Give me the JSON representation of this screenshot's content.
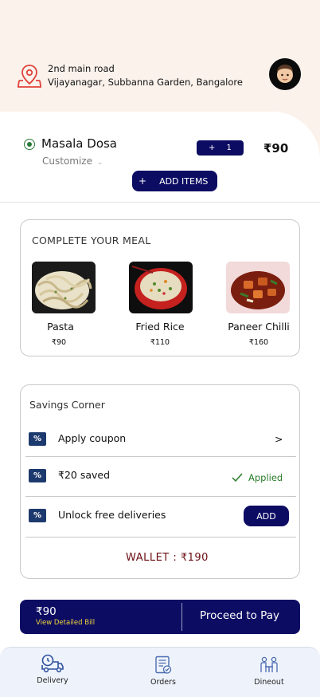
{
  "header": {
    "address_line1": "2nd main road",
    "address_line2": "Vijayanagar, Subbanna Garden, Bangalore"
  },
  "cart": {
    "item_name": "Masala Dosa",
    "customize_label": "Customize",
    "stepper_plus": "+",
    "quantity": "1",
    "item_price": "₹90",
    "add_items_plus": "+",
    "add_items_label": "ADD ITEMS"
  },
  "complete_meal": {
    "title": "COMPLETE YOUR MEAL",
    "items": [
      {
        "name": "Pasta",
        "price": "₹90"
      },
      {
        "name": "Fried Rice",
        "price": "₹110"
      },
      {
        "name": "Paneer Chilli",
        "price": "₹160"
      }
    ]
  },
  "savings": {
    "title": "Savings Corner",
    "percent_symbol": "%",
    "rows": [
      {
        "label": "Apply coupon",
        "action": ">"
      },
      {
        "label": "₹20 saved",
        "action": "Applied"
      },
      {
        "label": "Unlock free deliveries",
        "action": "ADD"
      }
    ],
    "wallet_label": "WALLET : ₹190"
  },
  "paybar": {
    "amount": "₹90",
    "detail_link": "View Detailed Bill",
    "proceed_label": "Proceed to Pay"
  },
  "bottom_nav": {
    "items": [
      {
        "label": "Delivery",
        "icon": "delivery-icon",
        "active": true
      },
      {
        "label": "Orders",
        "icon": "orders-icon",
        "active": false
      },
      {
        "label": "Dineout",
        "icon": "dineout-icon",
        "active": false
      }
    ]
  },
  "colors": {
    "primary": "#0c0c63",
    "header_bg": "#fbf2ec",
    "success": "#2a7c2a",
    "wallet": "#6b0e13",
    "detail_link": "#f0d33a",
    "pin": "#e0413a"
  }
}
